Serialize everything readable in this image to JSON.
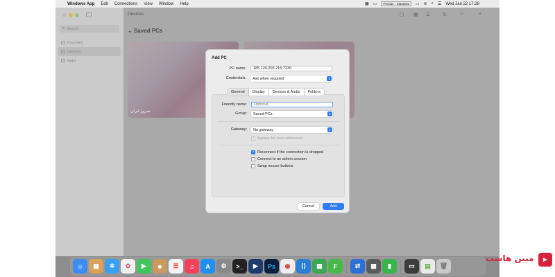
{
  "menubar": {
    "app_name": "Windows App",
    "items": [
      "Edit",
      "Connections",
      "View",
      "Window",
      "Help"
    ],
    "keyboard_layout": "Persian - Standard",
    "clock": "Wed Jan 22  17:28"
  },
  "sidebar": {
    "search_placeholder": "Search",
    "items": [
      {
        "label": "Favorites"
      },
      {
        "label": "Devices"
      },
      {
        "label": "Apps"
      }
    ]
  },
  "main": {
    "title": "Devices",
    "section": "Saved PCs",
    "cards": [
      {
        "label": "سرور ایران"
      },
      {
        "label": ""
      }
    ]
  },
  "dialog": {
    "title": "Add PC",
    "pc_name_label": "PC name:",
    "pc_name_value": "185.126.203.216:7230",
    "credentials_label": "Credentials:",
    "credentials_value": "Ask when required",
    "tabs": [
      "General",
      "Display",
      "Devices & Audio",
      "Folders"
    ],
    "friendly_name_label": "Friendly name:",
    "friendly_name_placeholder": "Optional",
    "group_label": "Group:",
    "group_value": "Saved PCs",
    "gateway_label": "Gateway:",
    "gateway_value": "No gateway",
    "bypass_label": "Bypass for local addresses",
    "reconnect_label": "Reconnect if the connection is dropped",
    "admin_label": "Connect to an admin session",
    "swap_label": "Swap mouse buttons",
    "cancel_label": "Cancel",
    "add_label": "Add"
  },
  "dock": {
    "icons": [
      "finder-icon",
      "launchpad-icon",
      "safari-icon",
      "photos-icon",
      "facetime-icon",
      "contacts-icon",
      "reminders-icon",
      "music-icon",
      "app-store-icon",
      "settings-icon",
      "terminal-icon",
      "remote-play-icon",
      "photoshop-icon",
      "chrome-icon",
      "vscode-icon",
      "windows-app-icon",
      "frames-icon",
      "screen-share-icon",
      "calculator-icon",
      "numbers-icon",
      "monitor-icon",
      "folder-icon",
      "trash-icon"
    ]
  },
  "branding": {
    "text": "مبین هاست"
  },
  "colors": {
    "accent": "#2f7cf6",
    "brand": "#d6223a"
  }
}
